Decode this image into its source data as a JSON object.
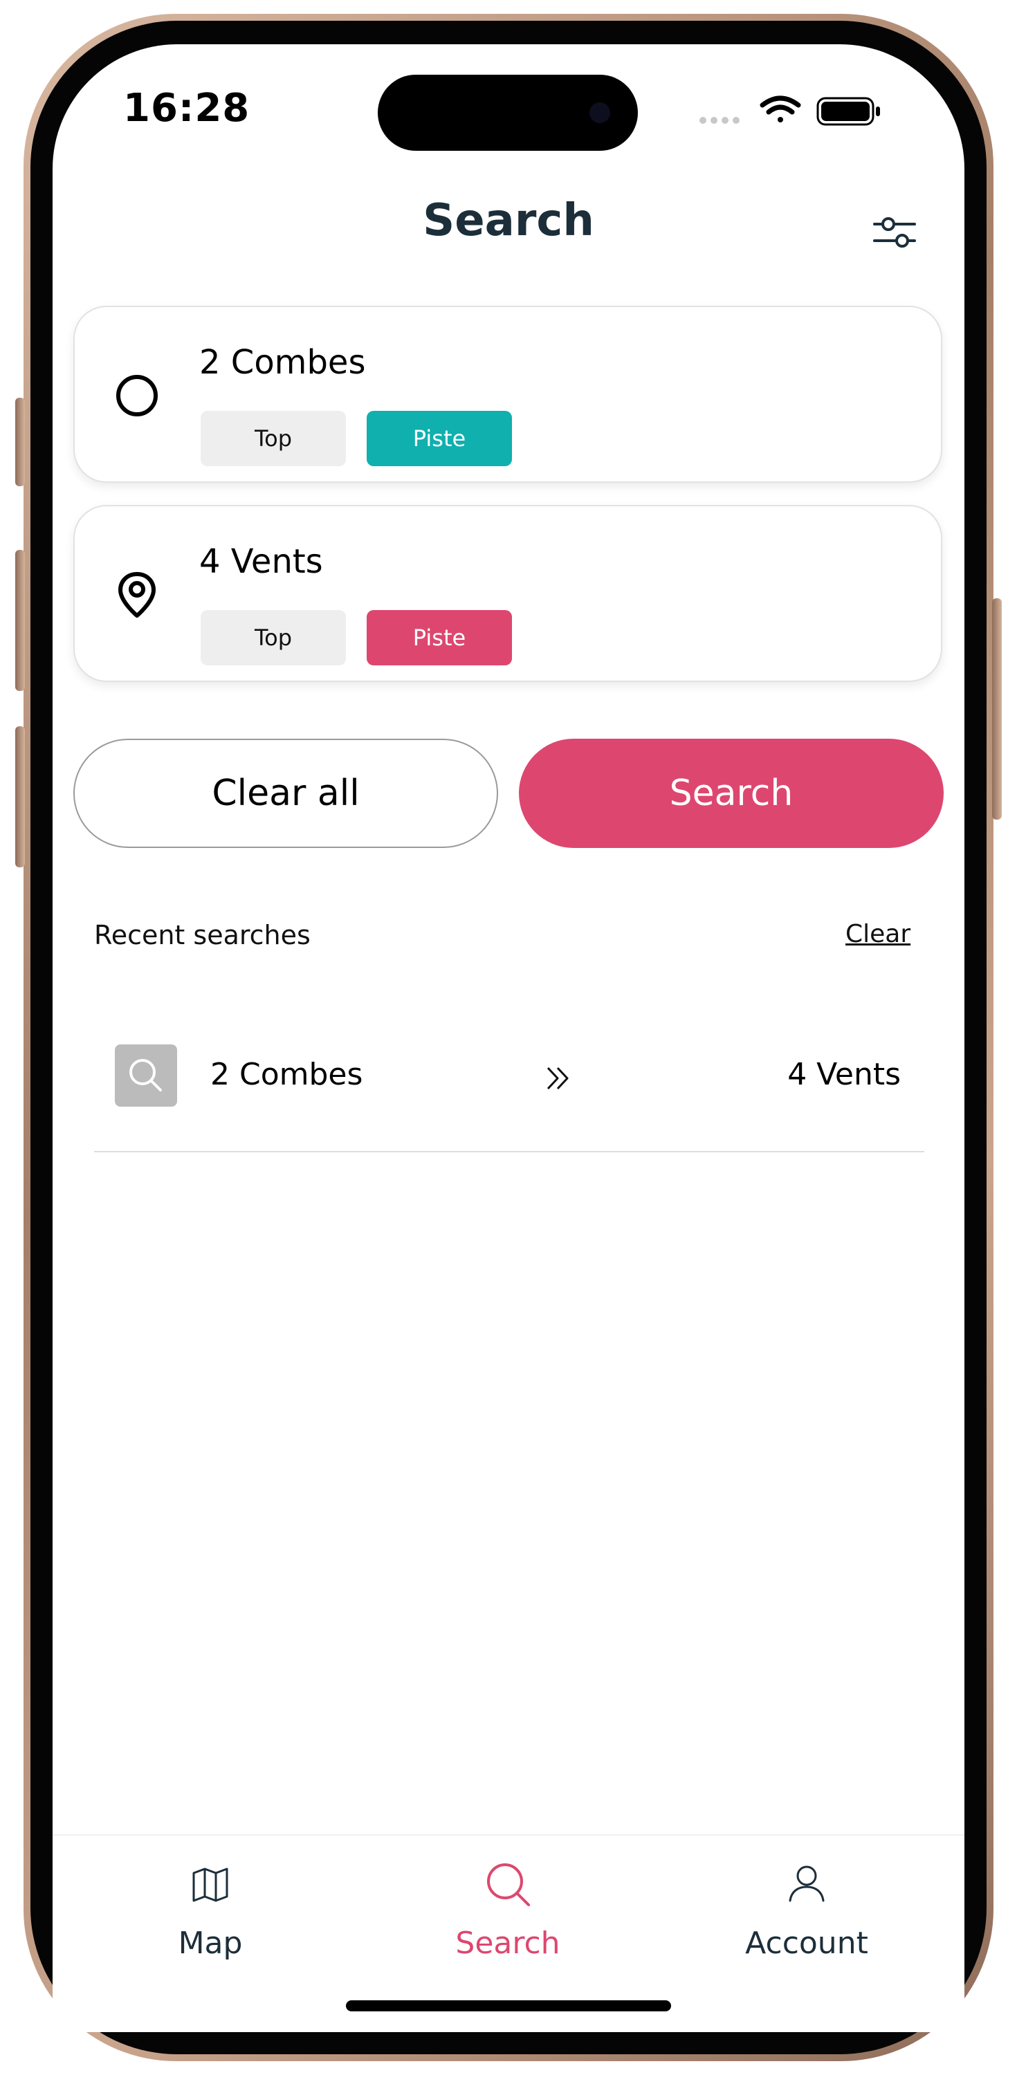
{
  "status_bar": {
    "time": "16:28",
    "icons": [
      "cellular-icon",
      "wifi-icon",
      "battery-icon"
    ]
  },
  "header": {
    "title": "Search",
    "filter_icon": "sliders-icon"
  },
  "origin": {
    "name": "2 Combes",
    "icon": "circle-icon",
    "chips": {
      "top": "Top",
      "piste": "Piste"
    },
    "piste_color": "#0fb0ae"
  },
  "destination": {
    "name": "4 Vents",
    "icon": "map-pin-icon",
    "chips": {
      "top": "Top",
      "piste": "Piste"
    },
    "piste_color": "#dd476f"
  },
  "actions": {
    "clear_all_label": "Clear all",
    "search_label": "Search"
  },
  "recent": {
    "heading": "Recent searches",
    "clear_label": "Clear",
    "items": [
      {
        "from": "2 Combes",
        "to": "4 Vents",
        "icon": "search-icon",
        "arrow_icon": "double-chevron-right-icon"
      }
    ]
  },
  "tab_bar": {
    "tabs": [
      {
        "label": "Map",
        "icon": "map-icon",
        "active": false
      },
      {
        "label": "Search",
        "icon": "search-icon",
        "active": true
      },
      {
        "label": "Account",
        "icon": "user-icon",
        "active": false
      }
    ]
  },
  "colors": {
    "accent": "#dd476f",
    "teal": "#0fb0ae",
    "title": "#1c2e3a",
    "tab_inactive": "#1c2e3a"
  }
}
